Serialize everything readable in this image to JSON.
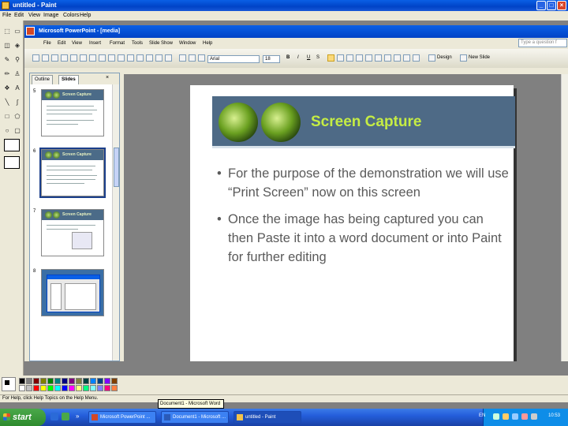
{
  "paint": {
    "title": "untitled - Paint",
    "menu": [
      "File",
      "Edit",
      "View",
      "Image",
      "Colors",
      "Help"
    ],
    "status_text": "For Help, click Help Topics on the Help Menu."
  },
  "powerpoint": {
    "title": "Microsoft PowerPoint - [media]",
    "menu": [
      "File",
      "Edit",
      "View",
      "Insert",
      "Format",
      "Tools",
      "Slide Show",
      "Window",
      "Help"
    ],
    "help_placeholder": "Type a question f",
    "font_name": "Arial",
    "font_size": "18",
    "bold": "B",
    "italic": "I",
    "underline": "U",
    "shadow": "S",
    "design_label": "Design",
    "new_slide_label": "New Slide",
    "tabs": [
      "Outline",
      "Slides"
    ],
    "thumbnails": [
      {
        "num": "5",
        "title": "Screen Capture"
      },
      {
        "num": "6",
        "title": "Screen Capture"
      },
      {
        "num": "7",
        "title": "Screen Capture"
      },
      {
        "num": "8",
        "title": ""
      }
    ],
    "slide": {
      "title": "Screen Capture",
      "bullets": [
        "For the purpose of the demonstration we will use “Print Screen” now on this screen",
        "Once the image has being captured you can then Paste it into a word document or into Paint for further editing"
      ]
    }
  },
  "tooltip": "Document1 - Microsoft Word",
  "taskbar": {
    "start_label": "start",
    "tasks": [
      "Microsoft PowerPoint ...",
      "Document1 - Microsoft ...",
      "untitled - Paint"
    ],
    "language": "EN",
    "clock": "10:53"
  },
  "colors": {
    "xp_blue": "#0043c6",
    "slide_header": "#4e6a86",
    "slide_title": "#c5ec44",
    "palette": [
      "#000000",
      "#808080",
      "#800000",
      "#808000",
      "#008000",
      "#008080",
      "#000080",
      "#800080",
      "#808040",
      "#004040",
      "#0080ff",
      "#004080",
      "#8000ff",
      "#804000",
      "#ffffff",
      "#c0c0c0",
      "#ff0000",
      "#ffff00",
      "#00ff00",
      "#00ffff",
      "#0000ff",
      "#ff00ff",
      "#ffff80",
      "#00ff80",
      "#80ffff",
      "#8080ff",
      "#ff0080",
      "#ff8040"
    ]
  }
}
